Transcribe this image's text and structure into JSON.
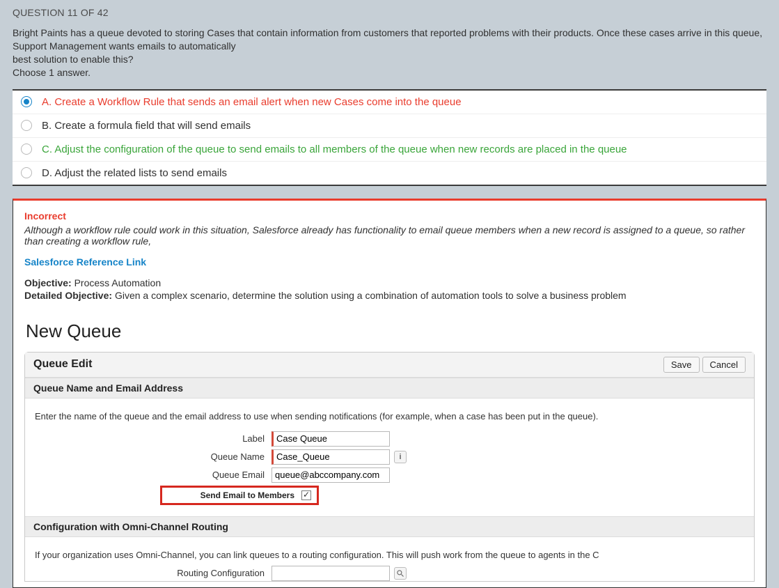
{
  "header": {
    "question_number": "QUESTION 11 OF 42"
  },
  "question": {
    "text": "Bright Paints has a queue devoted to storing Cases that contain information from customers that reported problems with their products. Once these cases arrive in this queue, Support Management wants emails to automatically",
    "text2": "best solution to enable this?",
    "instruction": "Choose 1 answer."
  },
  "answers": [
    {
      "label": "A. Create a Workflow Rule that sends an email alert when new Cases come into the queue",
      "selected": true,
      "style": "red"
    },
    {
      "label": "B. Create a formula field that will send emails",
      "selected": false,
      "style": "black"
    },
    {
      "label": "C. Adjust the configuration of the queue to send emails to all members of the queue when new records are placed in the queue",
      "selected": false,
      "style": "green"
    },
    {
      "label": "D. Adjust the related lists to send emails",
      "selected": false,
      "style": "black"
    }
  ],
  "feedback": {
    "status": "Incorrect",
    "explanation": "Although a workflow rule could work in this situation, Salesforce already has functionality to email queue members when a new record is assigned to a queue, so rather than creating a workflow rule,",
    "ref_link": "Salesforce Reference Link",
    "objective_label": "Objective:",
    "objective": "Process Automation",
    "detailed_label": "Detailed Objective:",
    "detailed": "Given a complex scenario, determine the solution using a combination of automation tools to solve a business problem"
  },
  "sf": {
    "title": "New Queue",
    "edit_heading": "Queue Edit",
    "save": "Save",
    "cancel": "Cancel",
    "section1": "Queue Name and Email Address",
    "section1_desc": "Enter the name of the queue and the email address to use when sending notifications (for example, when a case has been put in the queue).",
    "labels": {
      "label": "Label",
      "queue_name": "Queue Name",
      "queue_email": "Queue Email",
      "send_email": "Send Email to Members",
      "routing_config": "Routing Configuration"
    },
    "values": {
      "label": "Case Queue",
      "queue_name": "Case_Queue",
      "queue_email": "queue@abccompany.com"
    },
    "section2": "Configuration with Omni-Channel Routing",
    "section2_desc": "If your organization uses Omni-Channel, you can link queues to a routing configuration. This will push work from the queue to agents in the C"
  }
}
